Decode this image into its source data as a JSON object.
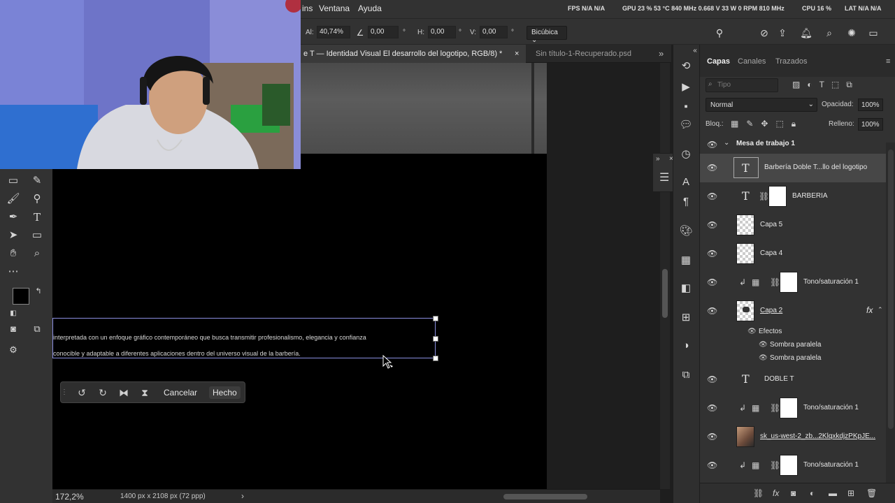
{
  "menubar": {
    "items": [
      "ins",
      "Ventana",
      "Ayuda"
    ],
    "sys": {
      "fps": "FPS N/A N/A",
      "gpu": "GPU 23 % 53 °C 840 MHz 0.668 V 33 W 0 RPM 810 MHz",
      "cpu": "CPU 16 %",
      "lat": "LAT N/A N/A"
    }
  },
  "options": {
    "al_label": "Al:",
    "al_value": "40,74%",
    "angle_value": "0,00",
    "h_label": "H:",
    "h_value": "0,00",
    "v_label": "V:",
    "v_value": "0,00",
    "deg": "°",
    "interp": "Bicúbica"
  },
  "tabs": [
    {
      "label": "e T — Identidad Visual  El desarrollo del logotipo, RGB/8) *",
      "close": "×"
    },
    {
      "label": "Sin título-1-Recuperado.psd"
    }
  ],
  "canvas": {
    "line1": "interpretada con un enfoque gráfico contemporáneo que busca transmitir profesionalismo, elegancia y confianza",
    "line2": "conocible y adaptable a diferentes aplicaciones dentro del universo visual de la barbería."
  },
  "transform": {
    "cancel": "Cancelar",
    "done": "Hecho"
  },
  "status": {
    "zoom": "172,2%",
    "size": "1400 px x 2108 px (72 ppp)",
    "arrow": "›"
  },
  "layers_panel": {
    "tabs": [
      "Capas",
      "Canales",
      "Trazados"
    ],
    "filter_placeholder": "Tipo",
    "blend_mode": "Normal",
    "opacity_label": "Opacidad:",
    "opacity_value": "100%",
    "lock_label": "Bloq.:",
    "fill_label": "Relleno:",
    "fill_value": "100%",
    "artboard": "Mesa de trabajo 1",
    "layers": [
      {
        "name": "Barbería Doble T...llo del logotipo",
        "kind": "text",
        "active": true
      },
      {
        "name": "BARBERIA",
        "kind": "text-mask"
      },
      {
        "name": "Capa 5",
        "kind": "pixel"
      },
      {
        "name": "Capa 4",
        "kind": "pixel"
      },
      {
        "name": "Tono/saturación 1",
        "kind": "adjust"
      },
      {
        "name": "Capa 2",
        "kind": "pixel-fx",
        "fx": "fx"
      },
      {
        "name": "DOBLE T",
        "kind": "text"
      },
      {
        "name": "Tono/saturación 1",
        "kind": "adjust"
      },
      {
        "name": "sk_us-west-2_zb...2KlqxkdjzPKpJE...",
        "kind": "image"
      },
      {
        "name": "Tono/saturación 1",
        "kind": "adjust"
      }
    ],
    "effects": {
      "title": "Efectos",
      "items": [
        "Sombra paralela",
        "Sombra paralela"
      ]
    }
  },
  "icons": {
    "eye": "eye-icon",
    "link": "link-icon",
    "adjust": "adjustment-icon",
    "text": "text-layer-icon"
  },
  "colors": {
    "selection": "#8a8ee0",
    "panel": "#323232",
    "active_layer": "#474747"
  }
}
